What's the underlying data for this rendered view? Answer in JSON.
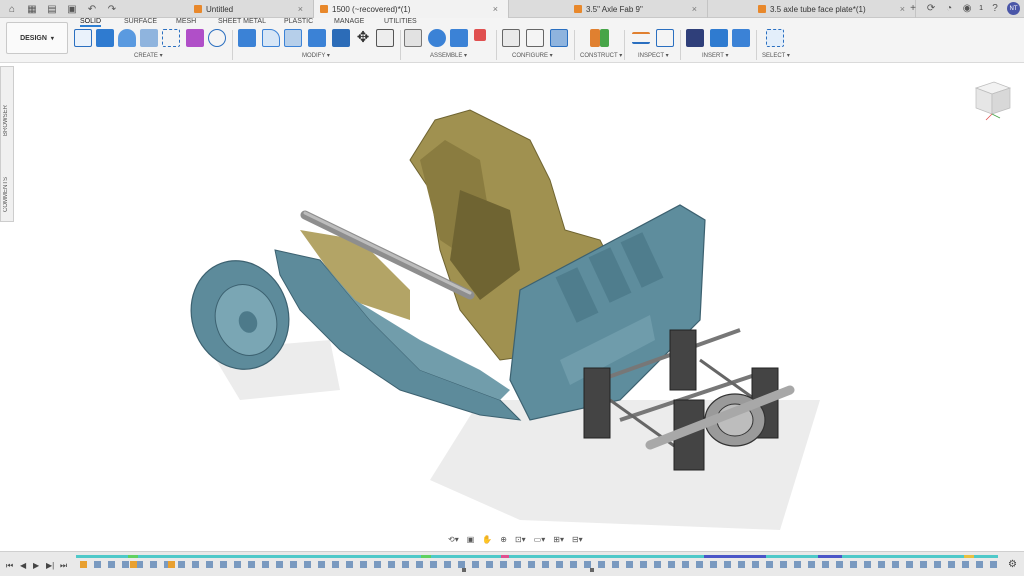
{
  "window": {
    "tabs": [
      {
        "label": "Untitled",
        "active": false
      },
      {
        "label": "1500 (~recovered)*(1)",
        "active": true
      },
      {
        "label": "3.5\" Axle Fab 9\"",
        "active": false
      },
      {
        "label": "3.5 axle tube face plate*(1)",
        "active": false
      }
    ],
    "user_initials": "NT",
    "notification_count": "1"
  },
  "ribbon": {
    "workspace": "DESIGN",
    "tabs": [
      "SOLID",
      "SURFACE",
      "MESH",
      "SHEET METAL",
      "PLASTIC",
      "MANAGE",
      "UTILITIES"
    ],
    "groups": [
      "CREATE",
      "MODIFY",
      "ASSEMBLE",
      "CONFIGURE",
      "CONSTRUCT",
      "INSPECT",
      "INSERT",
      "SELECT"
    ]
  },
  "side_panel": {
    "browser": "BROWSER",
    "comments": "COMMENTS"
  },
  "colors": {
    "accent": "#2d7fd3",
    "mesh_blue": "#5b8a9a",
    "mesh_tan": "#9a8a4a",
    "timeline_teal": "#4fc9c9"
  }
}
